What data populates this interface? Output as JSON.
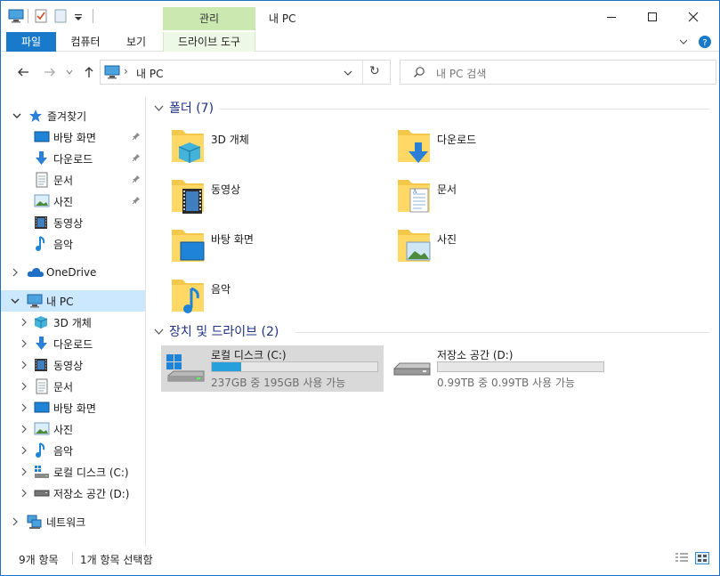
{
  "titlebar": {
    "context_tab_head": "관리",
    "title": "내 PC",
    "minimize": "—",
    "maximize": "☐",
    "close": "✕"
  },
  "ribbon": {
    "tabs": [
      "파일",
      "컴퓨터",
      "보기",
      "드라이브 도구"
    ]
  },
  "address": {
    "separator": "›",
    "location": "내 PC",
    "refresh": "↻"
  },
  "search": {
    "placeholder": "내 PC 검색"
  },
  "navpane": {
    "quick_access": "즐겨찾기",
    "quick_items": [
      "바탕 화면",
      "다운로드",
      "문서",
      "사진",
      "동영상",
      "음악"
    ],
    "onedrive": "OneDrive",
    "this_pc": "내 PC",
    "pc_items": [
      "3D 개체",
      "다운로드",
      "동영상",
      "문서",
      "바탕 화면",
      "사진",
      "음악",
      "로컬 디스크 (C:)",
      "저장소 공간 (D:)"
    ],
    "network": "네트워크"
  },
  "content": {
    "folders_header": "폴더 (7)",
    "folders": [
      "3D 개체",
      "다운로드",
      "동영상",
      "문서",
      "바탕 화면",
      "사진",
      "음악"
    ],
    "drives_header": "장치 및 드라이브 (2)",
    "drives": [
      {
        "name": "로컬 디스크 (C:)",
        "info": "237GB 중 195GB 사용 가능",
        "used_fraction": 0.18
      },
      {
        "name": "저장소 공간 (D:)",
        "info": "0.99TB 중 0.99TB 사용 가능",
        "used_fraction": 0.0
      }
    ]
  },
  "status": {
    "item_count": "9개 항목",
    "selected": "1개 항목 선택함"
  },
  "colors": {
    "accent": "#1979ca",
    "selection": "#cce8ff",
    "group_header": "#1e3287",
    "context_tab": "#cbe8b0",
    "progress": "#26a0da"
  }
}
